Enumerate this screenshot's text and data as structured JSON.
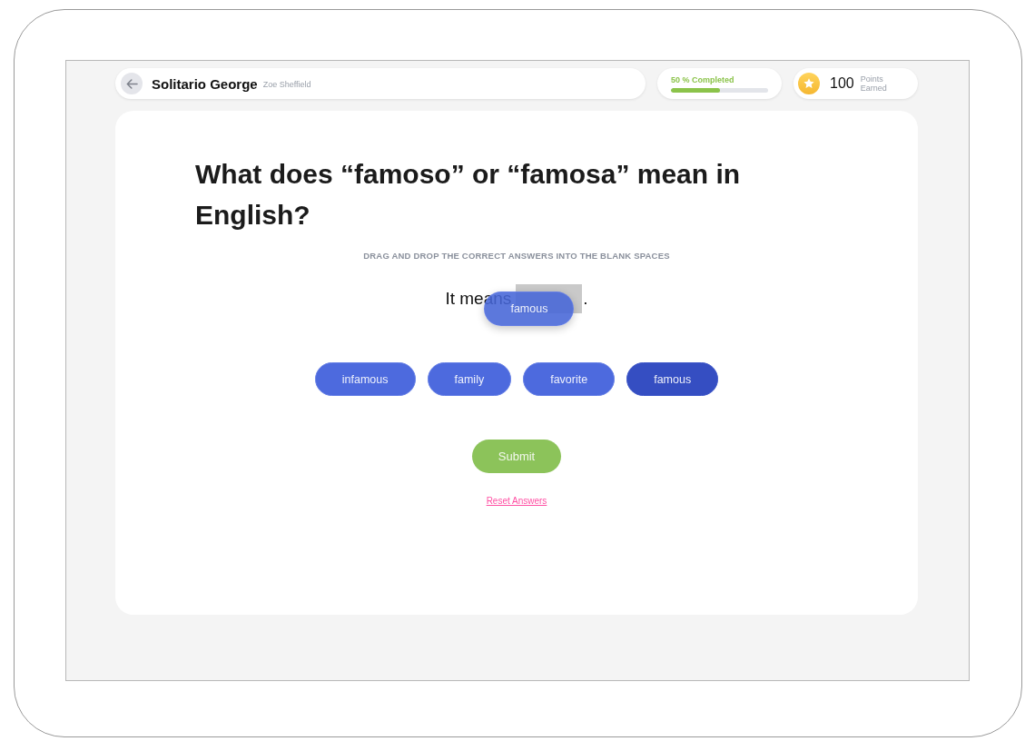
{
  "header": {
    "title": "Solitario George",
    "subtitle": "Zoe Sheffield"
  },
  "progress": {
    "label": "50 % Completed",
    "level": 0.5
  },
  "points": {
    "value": "100",
    "label": "Points Earned"
  },
  "question": {
    "title": "What does “famoso” or “famosa” mean in English?",
    "instruction": "DRAG AND DROP THE CORRECT ANSWERS INTO THE BLANK SPACES",
    "sentence": {
      "before": "It means",
      "after": "."
    },
    "dragging": {
      "label": "famous"
    }
  },
  "answers": [
    {
      "label": "infamous",
      "selected": false
    },
    {
      "label": "family",
      "selected": false
    },
    {
      "label": "favorite",
      "selected": false
    },
    {
      "label": "famous",
      "selected": true
    }
  ],
  "actions": {
    "submit": "Submit",
    "reset": "Reset Answers"
  }
}
